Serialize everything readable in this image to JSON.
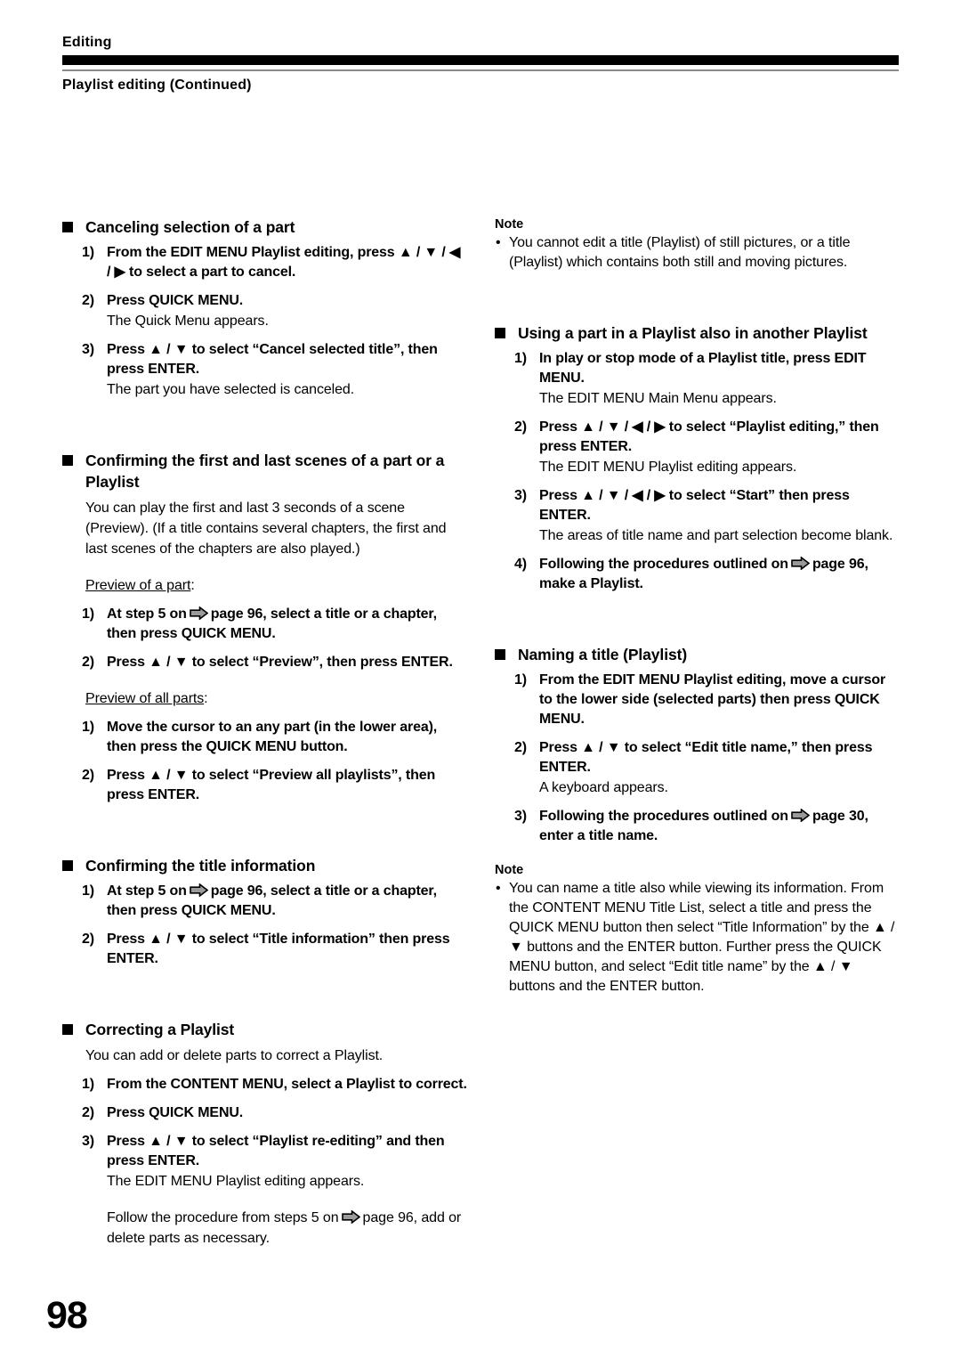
{
  "header": {
    "chapter": "Editing",
    "section": "Playlist editing (Continued)"
  },
  "page_number": "98",
  "icons": {
    "page_arrow": "right-arrow-icon",
    "square_bullet": "filled-square-bullet-icon",
    "up_triangle": "▲",
    "down_triangle": "▼",
    "left_triangle": "◀",
    "right_triangle": "▶"
  },
  "colors": {
    "text": "#000000",
    "rule_thick": "#000000",
    "rule_thin": "#8a8a8a",
    "arrow_fill": "#9a9a9a",
    "page_background": "#ffffff"
  },
  "left_column": {
    "s1": {
      "heading": "Canceling selection of a part",
      "step1_num": "1)",
      "step1_text": "From the EDIT MENU Playlist editing, press ▲ / ▼ / ◀ / ▶ to select a part to cancel.",
      "step2_num": "2)",
      "step2_text": "Press QUICK MENU.",
      "step2_sub": "The Quick Menu appears.",
      "step3_num": "3)",
      "step3_text": "Press ▲ / ▼ to select “Cancel selected title”, then press ENTER.",
      "step3_sub": "The part you have selected is canceled."
    },
    "s2": {
      "heading": "Confirming the first and last scenes of a part or a Playlist",
      "body": "You can play the first and last 3 seconds of a scene (Preview). (If a title contains several chapters, the first and last scenes of the chapters are also played.)",
      "lead1_underlined": "Preview of a part",
      "lead1_tail": ":",
      "p1_step1_num": "1)",
      "p1_step1_pre": "At step 5 on",
      "p1_step1_post": "page 96, select a title or a chapter, then press QUICK MENU.",
      "p1_step2_num": "2)",
      "p1_step2_text": "Press ▲ / ▼ to select “Preview”, then press ENTER.",
      "lead2_underlined": "Preview of all parts",
      "lead2_tail": ":",
      "p2_step1_num": "1)",
      "p2_step1_text": "Move the cursor to an any part (in the lower area), then press the QUICK MENU button.",
      "p2_step2_num": "2)",
      "p2_step2_text": "Press ▲ / ▼ to select “Preview all playlists”, then press ENTER."
    },
    "s3": {
      "heading": "Confirming the title information",
      "step1_num": "1)",
      "step1_pre": "At step 5 on",
      "step1_post": "page 96, select a title or a chapter, then press QUICK MENU.",
      "step2_num": "2)",
      "step2_text": "Press ▲ / ▼ to select “Title information” then press ENTER."
    },
    "s4": {
      "heading": "Correcting a Playlist",
      "body": "You can add or delete parts to correct a Playlist.",
      "step1_num": "1)",
      "step1_text": "From the CONTENT MENU, select a Playlist to correct.",
      "step2_num": "2)",
      "step2_text": "Press QUICK MENU.",
      "step3_num": "3)",
      "step3_text": "Press ▲ / ▼ to select “Playlist re-editing” and then press ENTER.",
      "step3_sub": "The EDIT MENU Playlist editing appears.",
      "closing_pre": "Follow the procedure from steps 5 on",
      "closing_post": "page 96, add or delete parts as necessary."
    }
  },
  "right_column": {
    "note1": {
      "label": "Note",
      "bullet": "•",
      "text": "You cannot edit a title (Playlist) of still pictures, or a title (Playlist) which contains both still and moving pictures."
    },
    "s5": {
      "heading": "Using a part in a Playlist also in another Playlist",
      "step1_num": "1)",
      "step1_text": "In play or stop mode of a Playlist title, press EDIT MENU.",
      "step1_sub": "The EDIT MENU Main Menu appears.",
      "step2_num": "2)",
      "step2_text": "Press ▲ / ▼ / ◀ / ▶  to select “Playlist editing,” then press ENTER.",
      "step2_sub": "The EDIT MENU Playlist editing appears.",
      "step3_num": "3)",
      "step3_text": "Press ▲ / ▼ / ◀ / ▶ to select “Start” then press ENTER.",
      "step3_sub": "The areas of title name and part selection become blank.",
      "step4_num": "4)",
      "step4_pre": "Following the procedures outlined on",
      "step4_post": "page 96, make a Playlist."
    },
    "s6": {
      "heading": "Naming a title (Playlist)",
      "step1_num": "1)",
      "step1_text": "From the EDIT MENU Playlist editing, move a cursor to the lower side (selected parts) then press QUICK MENU.",
      "step2_num": "2)",
      "step2_text": "Press ▲ / ▼ to select “Edit title name,” then press ENTER.",
      "step2_sub": "A keyboard appears.",
      "step3_num": "3)",
      "step3_pre": "Following the procedures outlined on",
      "step3_post": "30, enter a title name.",
      "step3_page_word": "page"
    },
    "note2": {
      "label": "Note",
      "bullet": "•",
      "text": "You can name a title also while viewing its information. From the CONTENT MENU Title List, select a title and press the QUICK MENU button then select “Title Information” by the ▲ / ▼ buttons and the ENTER button. Further press the QUICK MENU button, and select “Edit title name” by the ▲ / ▼ buttons and the ENTER button."
    }
  }
}
